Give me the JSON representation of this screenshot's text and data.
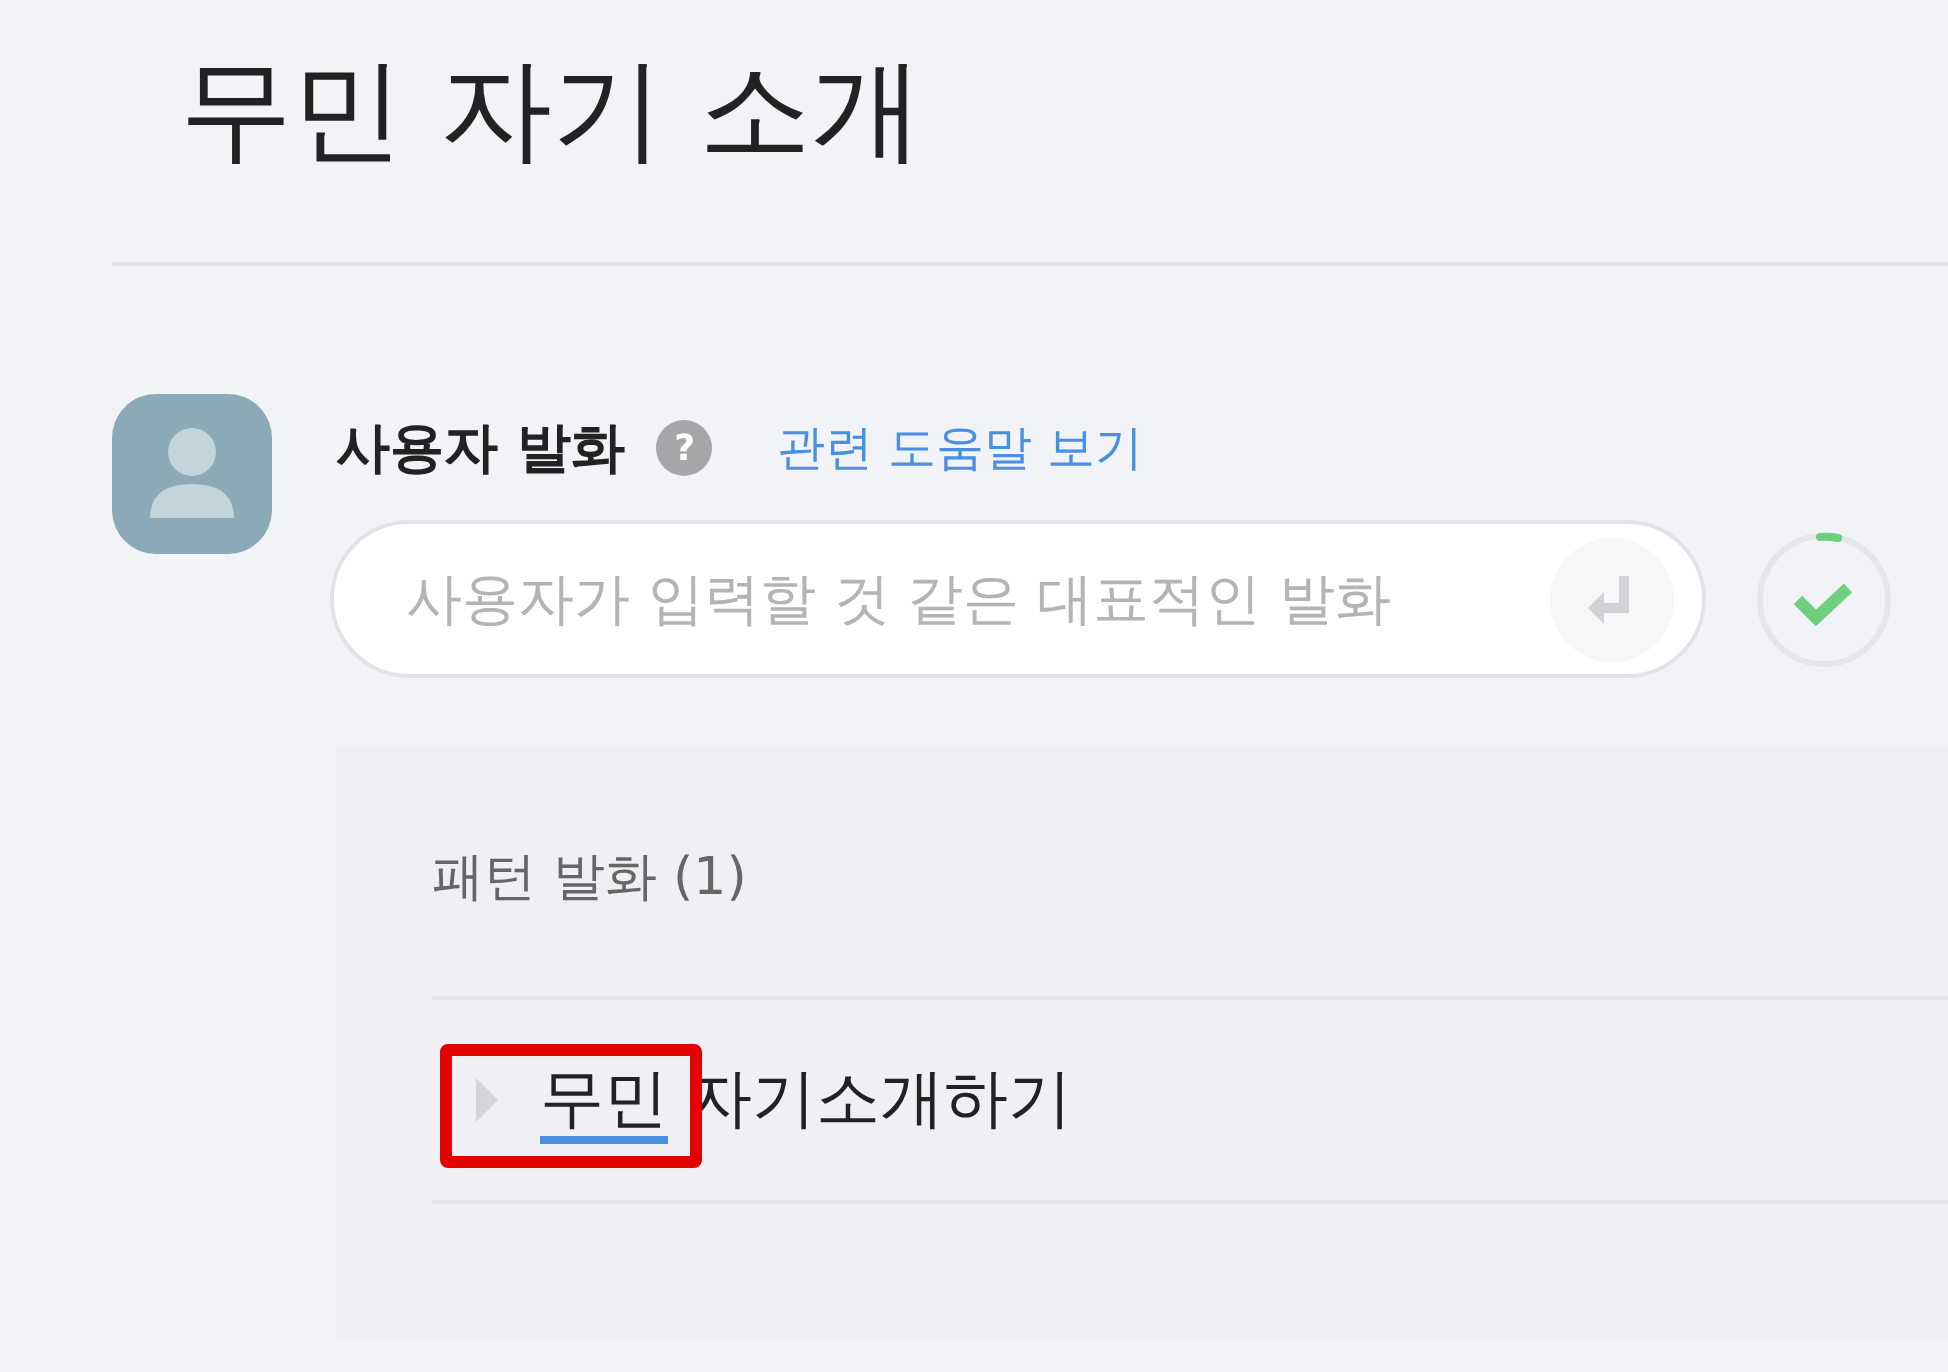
{
  "page_title": "무민 자기 소개",
  "utterance": {
    "label": "사용자 발화",
    "help_icon": "?",
    "help_link": "관련 도움말 보기",
    "placeholder": "사용자가 입력할 것 같은 대표적인 발화"
  },
  "patterns": {
    "heading": "패턴 발화 (1)",
    "items": [
      {
        "expanded": false,
        "highlighted": true,
        "segments": [
          {
            "text": "무민",
            "entity": true
          },
          {
            "text": " 자기소개하기",
            "entity": false
          }
        ]
      }
    ]
  }
}
